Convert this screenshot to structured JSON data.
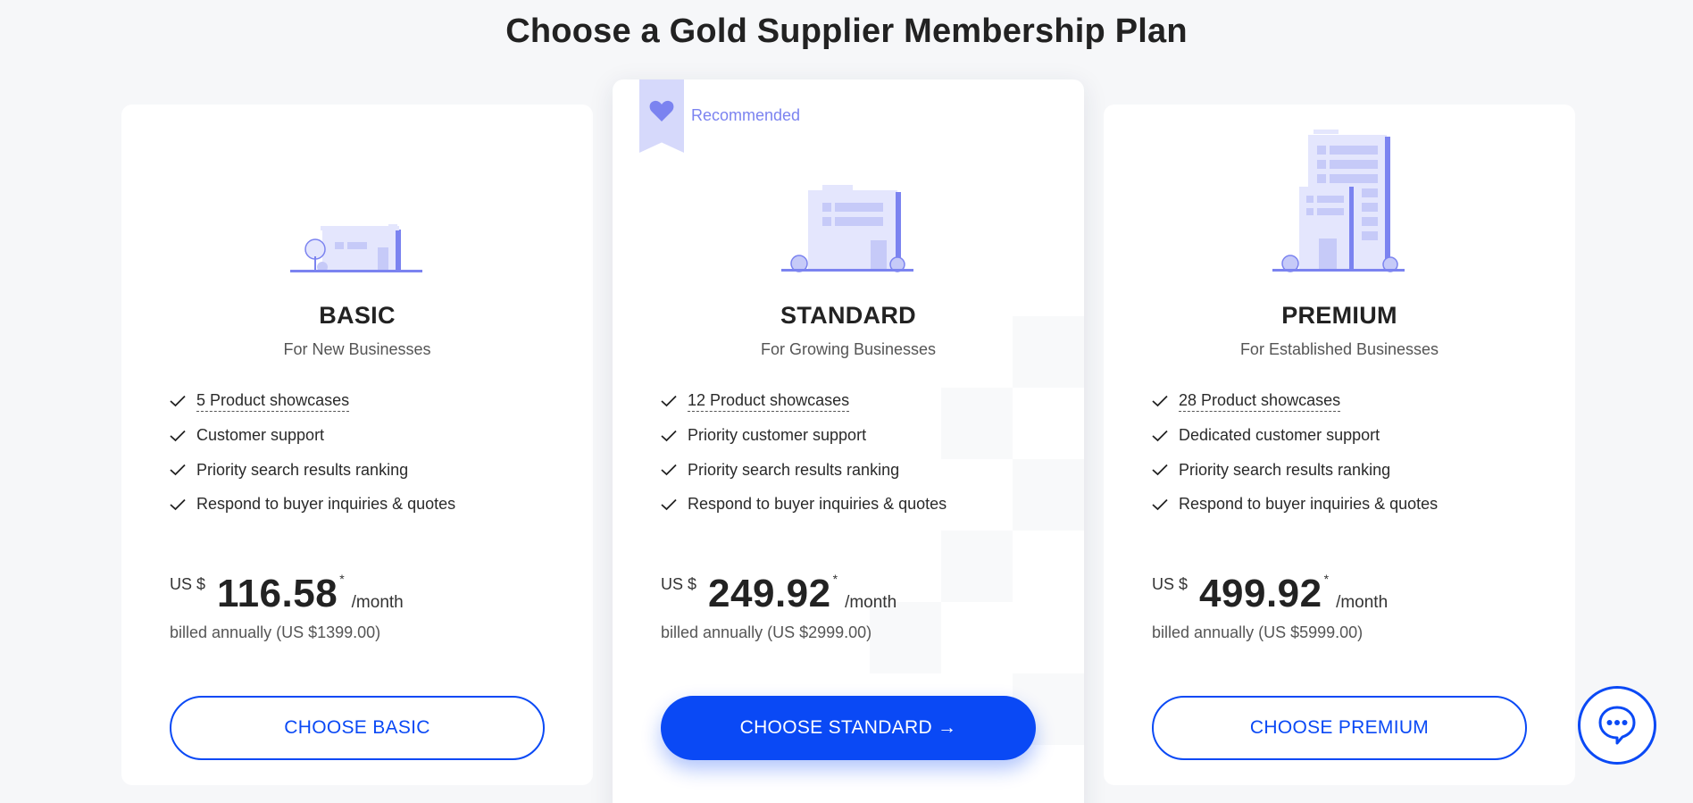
{
  "page_title": "Choose a Gold Supplier Membership Plan",
  "colors": {
    "accent": "#0a49f5",
    "illustration": "#7b83f0",
    "illustration_light": "#e4e6fd"
  },
  "plans": [
    {
      "name": "BASIC",
      "subtitle": "For New Businesses",
      "features": [
        "5 Product showcases",
        "Customer support",
        "Priority search results ranking",
        "Respond to buyer inquiries & quotes"
      ],
      "currency": "US $",
      "price": "116.58",
      "asterisk": "*",
      "period": "/month",
      "billed": "billed annually (US $1399.00)",
      "button": "CHOOSE BASIC",
      "icon": "small-shop-icon"
    },
    {
      "name": "STANDARD",
      "subtitle": "For Growing Businesses",
      "badge": "Recommended",
      "features": [
        "12 Product showcases",
        "Priority customer support",
        "Priority search results ranking",
        "Respond to buyer inquiries & quotes"
      ],
      "currency": "US $",
      "price": "249.92",
      "asterisk": "*",
      "period": "/month",
      "billed": "billed annually (US $2999.00)",
      "button": "CHOOSE STANDARD →",
      "icon": "office-building-icon"
    },
    {
      "name": "PREMIUM",
      "subtitle": "For Established Businesses",
      "features": [
        "28 Product showcases",
        "Dedicated customer support",
        "Priority search results ranking",
        "Respond to buyer inquiries & quotes"
      ],
      "currency": "US $",
      "price": "499.92",
      "asterisk": "*",
      "period": "/month",
      "billed": "billed annually (US $5999.00)",
      "button": "CHOOSE PREMIUM",
      "icon": "tower-building-icon"
    }
  ],
  "chat": {
    "icon": "chat-bubble-icon"
  }
}
